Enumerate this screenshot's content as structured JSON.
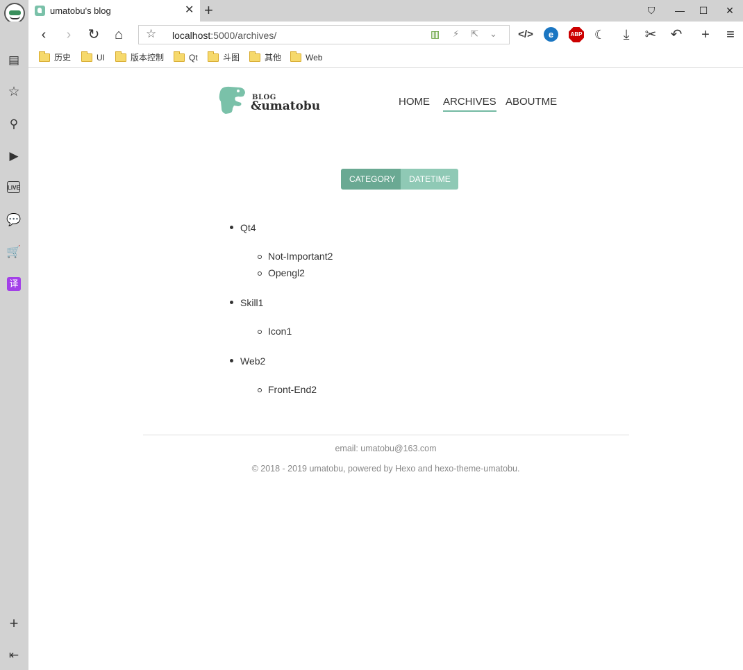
{
  "browser": {
    "tab_title": "umatobu's blog",
    "tab_close": "✕",
    "new_tab": "+",
    "url_host": "localhost",
    "url_rest": ":5000/archives/",
    "window_buttons": {
      "skin": "⛉",
      "minimize": "—",
      "maximize": "☐",
      "close": "✕"
    }
  },
  "bookmarks": [
    {
      "label": "历史"
    },
    {
      "label": "UI"
    },
    {
      "label": "版本控制"
    },
    {
      "label": "Qt"
    },
    {
      "label": "斗图"
    },
    {
      "label": "其他"
    },
    {
      "label": "Web"
    }
  ],
  "sidebar": {
    "live_label": "LIVE",
    "translate_label": "译"
  },
  "site": {
    "logo_small": "BLOG",
    "logo_big": "&umatobu",
    "nav": [
      {
        "label": "HOME",
        "active": false
      },
      {
        "label": "ARCHIVES",
        "active": true
      },
      {
        "label": "ABOUTME",
        "active": false
      }
    ],
    "toggle": {
      "category": "CATEGORY",
      "datetime": "DATETIME",
      "selected": "CATEGORY"
    },
    "categories": [
      {
        "name": "Qt4",
        "children": [
          "Not-Important2",
          "Opengl2"
        ]
      },
      {
        "name": "Skill1",
        "children": [
          "Icon1"
        ]
      },
      {
        "name": "Web2",
        "children": [
          "Front-End2"
        ]
      }
    ],
    "footer": {
      "email": "email: umatobu@163.com",
      "copyright": "© 2018 - 2019 umatobu, powered by Hexo and hexo-theme-umatobu."
    },
    "accent_color": "#73b9a2"
  }
}
